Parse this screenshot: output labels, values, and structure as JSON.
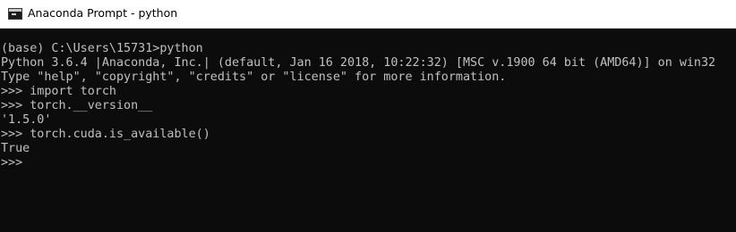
{
  "window": {
    "title": "Anaconda Prompt - python"
  },
  "console": {
    "lines": [
      "(base) C:\\Users\\15731>python",
      "Python 3.6.4 |Anaconda, Inc.| (default, Jan 16 2018, 10:22:32) [MSC v.1900 64 bit (AMD64)] on win32",
      "Type \"help\", \"copyright\", \"credits\" or \"license\" for more information.",
      ">>> import torch",
      ">>> torch.__version__",
      "'1.5.0'",
      ">>> torch.cuda.is_available()",
      "True",
      ">>>"
    ]
  },
  "colors": {
    "console_background": "#0c0c0c",
    "console_text": "#c0c0c0",
    "titlebar_background": "#ffffff"
  },
  "icons": {
    "title_icon": "console-window-icon"
  }
}
